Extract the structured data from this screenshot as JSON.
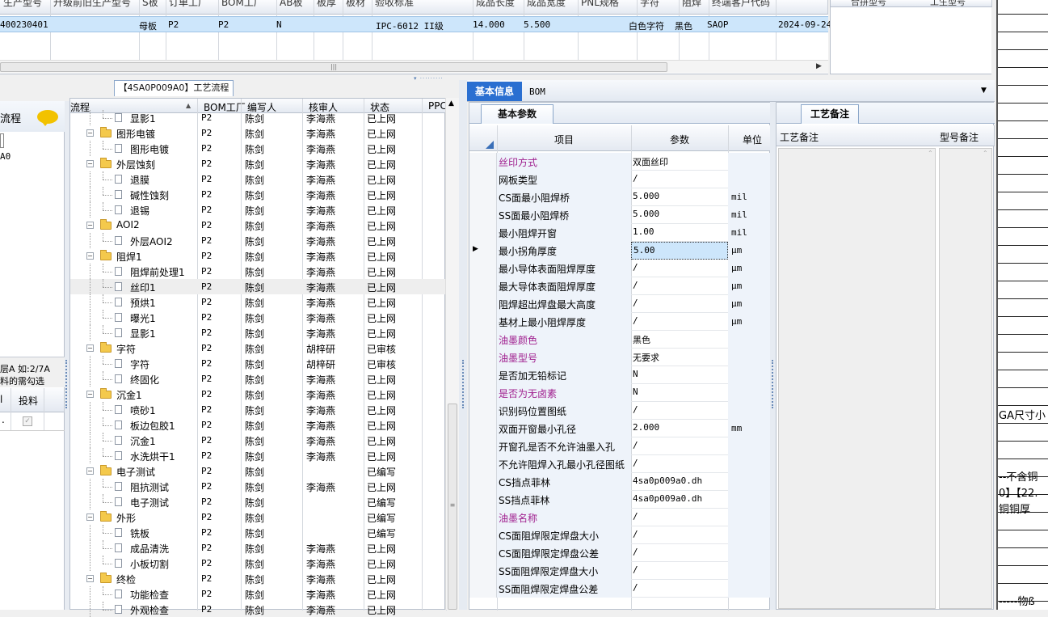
{
  "top_grid": {
    "headers": [
      "生产型号",
      "升级前旧生产型号",
      "S板",
      "订单工厂",
      "BOM工厂",
      "AB板",
      "板厚",
      "板材",
      "验收标准",
      "成品长度",
      "成品宽度",
      "PNL规格",
      "字符",
      "阻焊",
      "终端客户代码"
    ],
    "row": [
      "400230401",
      "",
      "母板",
      "P2",
      "P2",
      "N",
      "",
      "",
      "IPC-6012 II级",
      "14.000",
      "5.500",
      "",
      "白色字符",
      "黑色",
      "SAOP",
      "2024-09-24"
    ],
    "right_headers": [
      "合拼型号",
      "工生型号"
    ]
  },
  "tree_panel": {
    "title": "【4SA0P009A0】工艺流程",
    "headers": [
      "流程",
      "BOM工厂",
      "编写人",
      "核审人",
      "状态",
      "PPC"
    ],
    "rows": [
      {
        "level": 1,
        "label": "显影1",
        "factory": "P2",
        "writer": "陈剑",
        "reviewer": "李海燕",
        "status": "已上网"
      },
      {
        "level": 0,
        "label": "图形电镀",
        "factory": "P2",
        "writer": "陈剑",
        "reviewer": "李海燕",
        "status": "已上网"
      },
      {
        "level": 1,
        "label": "图形电镀",
        "factory": "P2",
        "writer": "陈剑",
        "reviewer": "李海燕",
        "status": "已上网"
      },
      {
        "level": 0,
        "label": "外层蚀刻",
        "factory": "P2",
        "writer": "陈剑",
        "reviewer": "李海燕",
        "status": "已上网"
      },
      {
        "level": 1,
        "label": "退膜",
        "factory": "P2",
        "writer": "陈剑",
        "reviewer": "李海燕",
        "status": "已上网"
      },
      {
        "level": 1,
        "label": "碱性蚀刻",
        "factory": "P2",
        "writer": "陈剑",
        "reviewer": "李海燕",
        "status": "已上网"
      },
      {
        "level": 1,
        "label": "退锡",
        "factory": "P2",
        "writer": "陈剑",
        "reviewer": "李海燕",
        "status": "已上网"
      },
      {
        "level": 0,
        "label": "AOI2",
        "factory": "P2",
        "writer": "陈剑",
        "reviewer": "李海燕",
        "status": "已上网"
      },
      {
        "level": 1,
        "label": "外层AOI2",
        "factory": "P2",
        "writer": "陈剑",
        "reviewer": "李海燕",
        "status": "已上网"
      },
      {
        "level": 0,
        "label": "阻焊1",
        "factory": "P2",
        "writer": "陈剑",
        "reviewer": "李海燕",
        "status": "已上网"
      },
      {
        "level": 1,
        "label": "阻焊前处理1",
        "factory": "P2",
        "writer": "陈剑",
        "reviewer": "李海燕",
        "status": "已上网"
      },
      {
        "level": 1,
        "label": "丝印1",
        "factory": "P2",
        "writer": "陈剑",
        "reviewer": "李海燕",
        "status": "已上网",
        "selected": true
      },
      {
        "level": 1,
        "label": "预烘1",
        "factory": "P2",
        "writer": "陈剑",
        "reviewer": "李海燕",
        "status": "已上网"
      },
      {
        "level": 1,
        "label": "曝光1",
        "factory": "P2",
        "writer": "陈剑",
        "reviewer": "李海燕",
        "status": "已上网"
      },
      {
        "level": 1,
        "label": "显影1",
        "factory": "P2",
        "writer": "陈剑",
        "reviewer": "李海燕",
        "status": "已上网"
      },
      {
        "level": 0,
        "label": "字符",
        "factory": "P2",
        "writer": "陈剑",
        "reviewer": "胡梓研",
        "status": "已审核"
      },
      {
        "level": 1,
        "label": "字符",
        "factory": "P2",
        "writer": "陈剑",
        "reviewer": "胡梓研",
        "status": "已审核"
      },
      {
        "level": 1,
        "label": "终固化",
        "factory": "P2",
        "writer": "陈剑",
        "reviewer": "李海燕",
        "status": "已上网"
      },
      {
        "level": 0,
        "label": "沉金1",
        "factory": "P2",
        "writer": "陈剑",
        "reviewer": "李海燕",
        "status": "已上网"
      },
      {
        "level": 1,
        "label": "喷砂1",
        "factory": "P2",
        "writer": "陈剑",
        "reviewer": "李海燕",
        "status": "已上网"
      },
      {
        "level": 1,
        "label": "板边包胶1",
        "factory": "P2",
        "writer": "陈剑",
        "reviewer": "李海燕",
        "status": "已上网"
      },
      {
        "level": 1,
        "label": "沉金1",
        "factory": "P2",
        "writer": "陈剑",
        "reviewer": "李海燕",
        "status": "已上网"
      },
      {
        "level": 1,
        "label": "水洗烘干1",
        "factory": "P2",
        "writer": "陈剑",
        "reviewer": "李海燕",
        "status": "已上网"
      },
      {
        "level": 0,
        "label": "电子测试",
        "factory": "P2",
        "writer": "陈剑",
        "reviewer": "",
        "status": "已编写"
      },
      {
        "level": 1,
        "label": "阻抗测试",
        "factory": "P2",
        "writer": "陈剑",
        "reviewer": "李海燕",
        "status": "已上网"
      },
      {
        "level": 1,
        "label": "电子测试",
        "factory": "P2",
        "writer": "陈剑",
        "reviewer": "",
        "status": "已编写"
      },
      {
        "level": 0,
        "label": "外形",
        "factory": "P2",
        "writer": "陈剑",
        "reviewer": "",
        "status": "已编写"
      },
      {
        "level": 1,
        "label": "铣板",
        "factory": "P2",
        "writer": "陈剑",
        "reviewer": "",
        "status": "已编写"
      },
      {
        "level": 1,
        "label": "成品清洗",
        "factory": "P2",
        "writer": "陈剑",
        "reviewer": "李海燕",
        "status": "已上网"
      },
      {
        "level": 1,
        "label": "小板切割",
        "factory": "P2",
        "writer": "陈剑",
        "reviewer": "李海燕",
        "status": "已上网"
      },
      {
        "level": 0,
        "label": "终检",
        "factory": "P2",
        "writer": "陈剑",
        "reviewer": "李海燕",
        "status": "已上网"
      },
      {
        "level": 1,
        "label": "功能检查",
        "factory": "P2",
        "writer": "陈剑",
        "reviewer": "李海燕",
        "status": "已上网"
      },
      {
        "level": 1,
        "label": "外观检查",
        "factory": "P2",
        "writer": "陈剑",
        "reviewer": "李海燕",
        "status": "已上网"
      }
    ]
  },
  "left_panel": {
    "title": "流程",
    "item": "A0",
    "note1": "层A 如:2/7A",
    "note2": "料的需勾选",
    "col1": "l",
    "col2": "投料",
    "val1": "."
  },
  "tabs": {
    "active": "基本信息",
    "other": "BOM"
  },
  "params": {
    "tab": "基本参数",
    "headers": [
      "项目",
      "参数",
      "单位"
    ],
    "rows": [
      {
        "item": "丝印方式",
        "value": "双面丝印",
        "unit": "",
        "pink": true
      },
      {
        "item": "网板类型",
        "value": "/",
        "unit": ""
      },
      {
        "item": "CS面最小阻焊桥",
        "value": "5.000",
        "unit": "mil"
      },
      {
        "item": "SS面最小阻焊桥",
        "value": "5.000",
        "unit": "mil"
      },
      {
        "item": "最小阻焊开窗",
        "value": "1.00",
        "unit": "mil"
      },
      {
        "item": "最小拐角厚度",
        "value": "5.00",
        "unit": "μm",
        "current": true
      },
      {
        "item": "最小导体表面阻焊厚度",
        "value": "/",
        "unit": "μm"
      },
      {
        "item": "最大导体表面阻焊厚度",
        "value": "/",
        "unit": "μm"
      },
      {
        "item": "阻焊超出焊盘最大高度",
        "value": "/",
        "unit": "μm"
      },
      {
        "item": "基材上最小阻焊厚度",
        "value": "/",
        "unit": "μm"
      },
      {
        "item": "油墨颜色",
        "value": "黑色",
        "unit": "",
        "pink": true
      },
      {
        "item": "油墨型号",
        "value": "无要求",
        "unit": "",
        "pink": true
      },
      {
        "item": "是否加无铅标记",
        "value": "N",
        "unit": ""
      },
      {
        "item": "是否为无卤素",
        "value": "N",
        "unit": "",
        "pink": true
      },
      {
        "item": "识别码位置图纸",
        "value": "/",
        "unit": ""
      },
      {
        "item": "双面开窗最小孔径",
        "value": "2.000",
        "unit": "mm"
      },
      {
        "item": "开窗孔是否不允许油墨入孔",
        "value": "/",
        "unit": ""
      },
      {
        "item": "不允许阻焊入孔最小孔径图纸",
        "value": "/",
        "unit": ""
      },
      {
        "item": "CS挡点菲林",
        "value": "4sa0p009a0.dh",
        "unit": ""
      },
      {
        "item": "SS挡点菲林",
        "value": "4sa0p009a0.dh",
        "unit": ""
      },
      {
        "item": "油墨名称",
        "value": "/",
        "unit": "",
        "pink": true
      },
      {
        "item": "CS面阻焊限定焊盘大小",
        "value": "/",
        "unit": ""
      },
      {
        "item": "CS面阻焊限定焊盘公差",
        "value": "/",
        "unit": ""
      },
      {
        "item": "SS面阻焊限定焊盘大小",
        "value": "/",
        "unit": ""
      },
      {
        "item": "SS面阻焊限定焊盘公差",
        "value": "/",
        "unit": ""
      }
    ]
  },
  "notes": {
    "tab": "工艺备注",
    "col1": "工艺备注",
    "col2": "型号备注"
  },
  "far_right": [
    "GA尺寸小",
    "--不含铜",
    "0】【22.",
    "铜铜厚",
    "-----物ß"
  ]
}
